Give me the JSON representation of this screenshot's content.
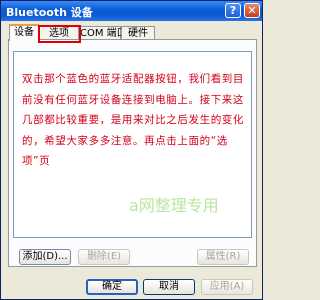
{
  "window": {
    "title": "Bluetooth 设备",
    "help_glyph": "?",
    "close_glyph": "✕"
  },
  "tabs": [
    {
      "label": "设备"
    },
    {
      "label": "选项"
    },
    {
      "label": "COM 端口"
    },
    {
      "label": "硬件"
    }
  ],
  "annotation": {
    "text": "双击那个蓝色的蓝牙适配器按钮，我们看到目前没有任何蓝牙设备连接到电脑上。接下来这几部都比较重要，是用来对比之后发生的变化的，希望大家多多注意。再点击上面的“选项”页",
    "watermark": "a网整理专用",
    "color": "#d4001a",
    "highlight_color": "#e00000"
  },
  "panel_buttons": {
    "add": "添加(D)...",
    "remove": "删除(E)",
    "properties": "属性(R)"
  },
  "footer_buttons": {
    "ok": "确定",
    "cancel": "取消",
    "apply": "应用(A)"
  },
  "colors": {
    "titlebar": "#0a5fd8",
    "dialog_bg": "#ece9d8",
    "tab_accent": "#e8a03c"
  }
}
